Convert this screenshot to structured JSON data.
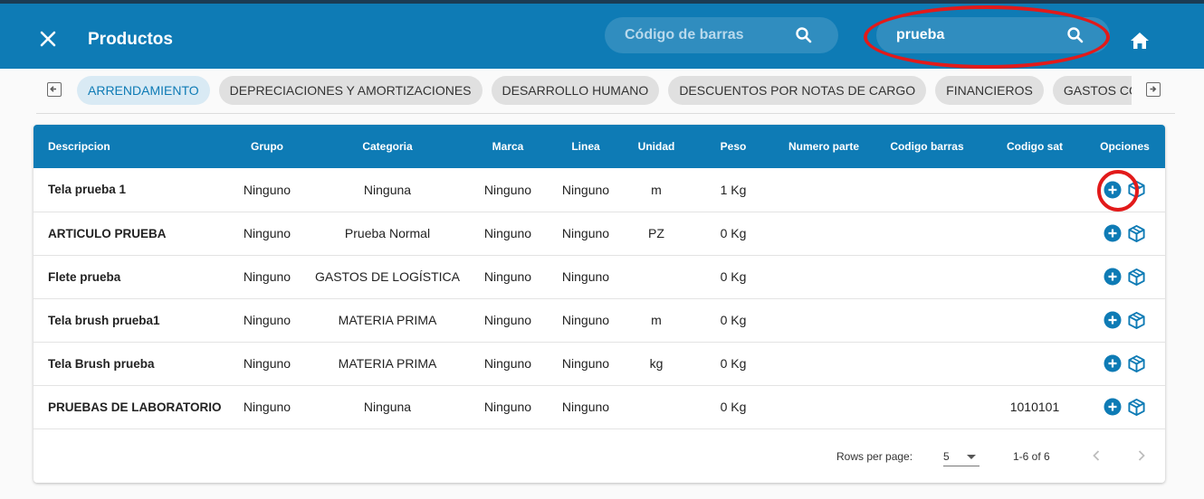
{
  "header": {
    "title": "Productos",
    "barcode_placeholder": "Código de barras",
    "search_value": "prueba"
  },
  "categories": [
    "ARRENDAMIENTO",
    "DEPRECIACIONES Y AMORTIZACIONES",
    "DESARROLLO HUMANO",
    "DESCUENTOS POR NOTAS DE CARGO",
    "FINANCIEROS",
    "GASTOS COMERCIALES"
  ],
  "table": {
    "columns": [
      "Descripcion",
      "Grupo",
      "Categoria",
      "Marca",
      "Linea",
      "Unidad",
      "Peso",
      "Numero parte",
      "Codigo barras",
      "Codigo sat",
      "Opciones"
    ],
    "rows": [
      {
        "descripcion": "Tela prueba 1",
        "grupo": "Ninguno",
        "categoria": "Ninguna",
        "marca": "Ninguno",
        "linea": "Ninguno",
        "unidad": "m",
        "peso": "1 Kg",
        "numero_parte": "",
        "codigo_barras": "",
        "codigo_sat": ""
      },
      {
        "descripcion": "ARTICULO PRUEBA",
        "grupo": "Ninguno",
        "categoria": "Prueba Normal",
        "marca": "Ninguno",
        "linea": "Ninguno",
        "unidad": "PZ",
        "peso": "0 Kg",
        "numero_parte": "",
        "codigo_barras": "",
        "codigo_sat": ""
      },
      {
        "descripcion": "Flete prueba",
        "grupo": "Ninguno",
        "categoria": "GASTOS DE LOGÍSTICA",
        "marca": "Ninguno",
        "linea": "Ninguno",
        "unidad": "",
        "peso": "0 Kg",
        "numero_parte": "",
        "codigo_barras": "",
        "codigo_sat": ""
      },
      {
        "descripcion": "Tela brush prueba1",
        "grupo": "Ninguno",
        "categoria": "MATERIA PRIMA",
        "marca": "Ninguno",
        "linea": "Ninguno",
        "unidad": "m",
        "peso": "0 Kg",
        "numero_parte": "",
        "codigo_barras": "",
        "codigo_sat": ""
      },
      {
        "descripcion": "Tela Brush prueba",
        "grupo": "Ninguno",
        "categoria": "MATERIA PRIMA",
        "marca": "Ninguno",
        "linea": "Ninguno",
        "unidad": "kg",
        "peso": "0 Kg",
        "numero_parte": "",
        "codigo_barras": "",
        "codigo_sat": ""
      },
      {
        "descripcion": "PRUEBAS DE LABORATORIO",
        "grupo": "Ninguno",
        "categoria": "Ninguna",
        "marca": "Ninguno",
        "linea": "Ninguno",
        "unidad": "",
        "peso": "0 Kg",
        "numero_parte": "",
        "codigo_barras": "",
        "codigo_sat": "1010101"
      }
    ]
  },
  "pagination": {
    "rows_per_page_label": "Rows per page:",
    "rows_per_page": "5",
    "range": "1-6 of 6"
  },
  "icons": {
    "close": "close-icon",
    "search": "search-icon",
    "home": "home-icon",
    "add": "add-circle-icon",
    "package": "package-icon"
  },
  "colors": {
    "primary": "#0e7bb5",
    "annotation": "#e21a1a"
  }
}
